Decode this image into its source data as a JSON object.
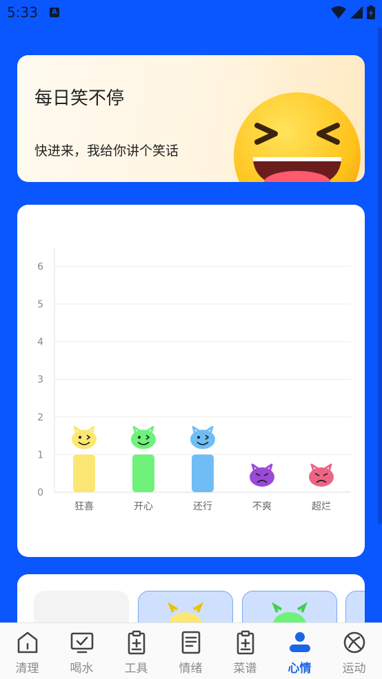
{
  "status": {
    "time": "5:33",
    "indicator": "A"
  },
  "banner": {
    "title": "每日笑不停",
    "subtitle": "快进来，我给你讲个笑话",
    "emoji": "laughing-face-emoji"
  },
  "chart_data": {
    "type": "bar",
    "categories": [
      "狂喜",
      "开心",
      "还行",
      "不爽",
      "超烂"
    ],
    "values": [
      1,
      1,
      1,
      0,
      0
    ],
    "colors": [
      "#fde774",
      "#6ef27a",
      "#70bdf6",
      "#9a4ad6",
      "#ec6486"
    ],
    "yticks": [
      "0",
      "1",
      "2",
      "3",
      "4",
      "5",
      "6"
    ],
    "ylim": [
      0,
      6
    ],
    "grid": true
  },
  "tabs": [
    {
      "label": "清理",
      "icon": "home-icon"
    },
    {
      "label": "喝水",
      "icon": "monitor-icon"
    },
    {
      "label": "工具",
      "icon": "clipboard-icon"
    },
    {
      "label": "情绪",
      "icon": "document-icon"
    },
    {
      "label": "菜谱",
      "icon": "clipboard-plus-icon"
    },
    {
      "label": "心情",
      "icon": "person-icon",
      "active": true
    },
    {
      "label": "运动",
      "icon": "ball-icon"
    }
  ]
}
